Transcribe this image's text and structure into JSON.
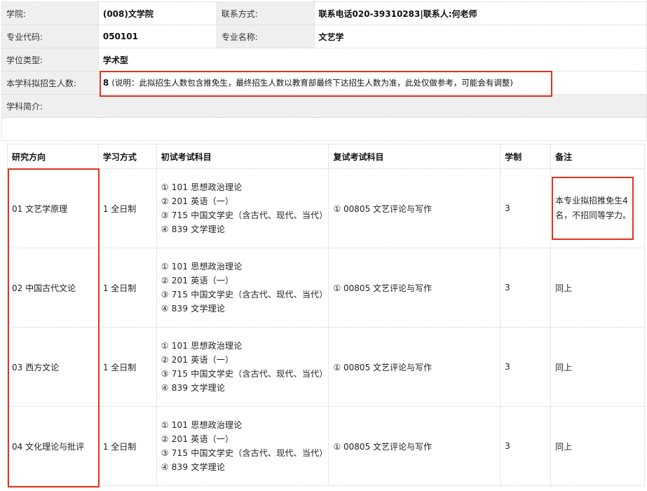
{
  "info": {
    "college_label": "学院:",
    "college_value": "(008)文学院",
    "contact_label": "联系方式:",
    "contact_value": "联系电话020-39310283|联系人:何老师",
    "code_label": "专业代码:",
    "code_value": "050101",
    "name_label": "专业名称:",
    "name_value": "文艺学",
    "degree_label": "学位类型:",
    "degree_value": "学术型",
    "enroll_label": "本学科拟招生人数:",
    "enroll_value": "8",
    "enroll_note": "(说明：此拟招生人数包含推免生，最终招生人数以教育部最终下达招生人数为准，此处仅做参考，可能会有调整)",
    "intro_label": "学科简介:"
  },
  "table": {
    "headers": [
      "研究方向",
      "学习方式",
      "初试考试科目",
      "复试考试科目",
      "学制",
      "备注"
    ],
    "rows": [
      {
        "direction": "01 文艺学原理",
        "mode": "1 全日制",
        "subjects": [
          "① 101 思想政治理论",
          "② 201 英语（一）",
          "③ 715 中国文学史（含古代、现代、当代）",
          "④ 839 文学理论"
        ],
        "retest": "① 00805 文艺评论与写作",
        "years": "3",
        "remark": "本专业拟招推免生4名，不招同等学力。"
      },
      {
        "direction": "02 中国古代文论",
        "mode": "1 全日制",
        "subjects": [
          "① 101 思想政治理论",
          "② 201 英语（一）",
          "③ 715 中国文学史（含古代、现代、当代）",
          "④ 839 文学理论"
        ],
        "retest": "① 00805 文艺评论与写作",
        "years": "3",
        "remark": "同上"
      },
      {
        "direction": "03 西方文论",
        "mode": "1 全日制",
        "subjects": [
          "① 101 思想政治理论",
          "② 201 英语（一）",
          "③ 715 中国文学史（含古代、现代、当代）",
          "④ 839 文学理论"
        ],
        "retest": "① 00805 文艺评论与写作",
        "years": "3",
        "remark": "同上"
      },
      {
        "direction": "04 文化理论与批评",
        "mode": "1 全日制",
        "subjects": [
          "① 101 思想政治理论",
          "② 201 英语（一）",
          "③ 715 中国文学史（含古代、现代、当代）",
          "④ 839 文学理论"
        ],
        "retest": "① 00805 文艺评论与写作",
        "years": "3",
        "remark": "同上"
      }
    ]
  },
  "colors": {
    "highlight": "#e0321e",
    "label_bg": "#efefef",
    "border": "#cfcfcf"
  }
}
